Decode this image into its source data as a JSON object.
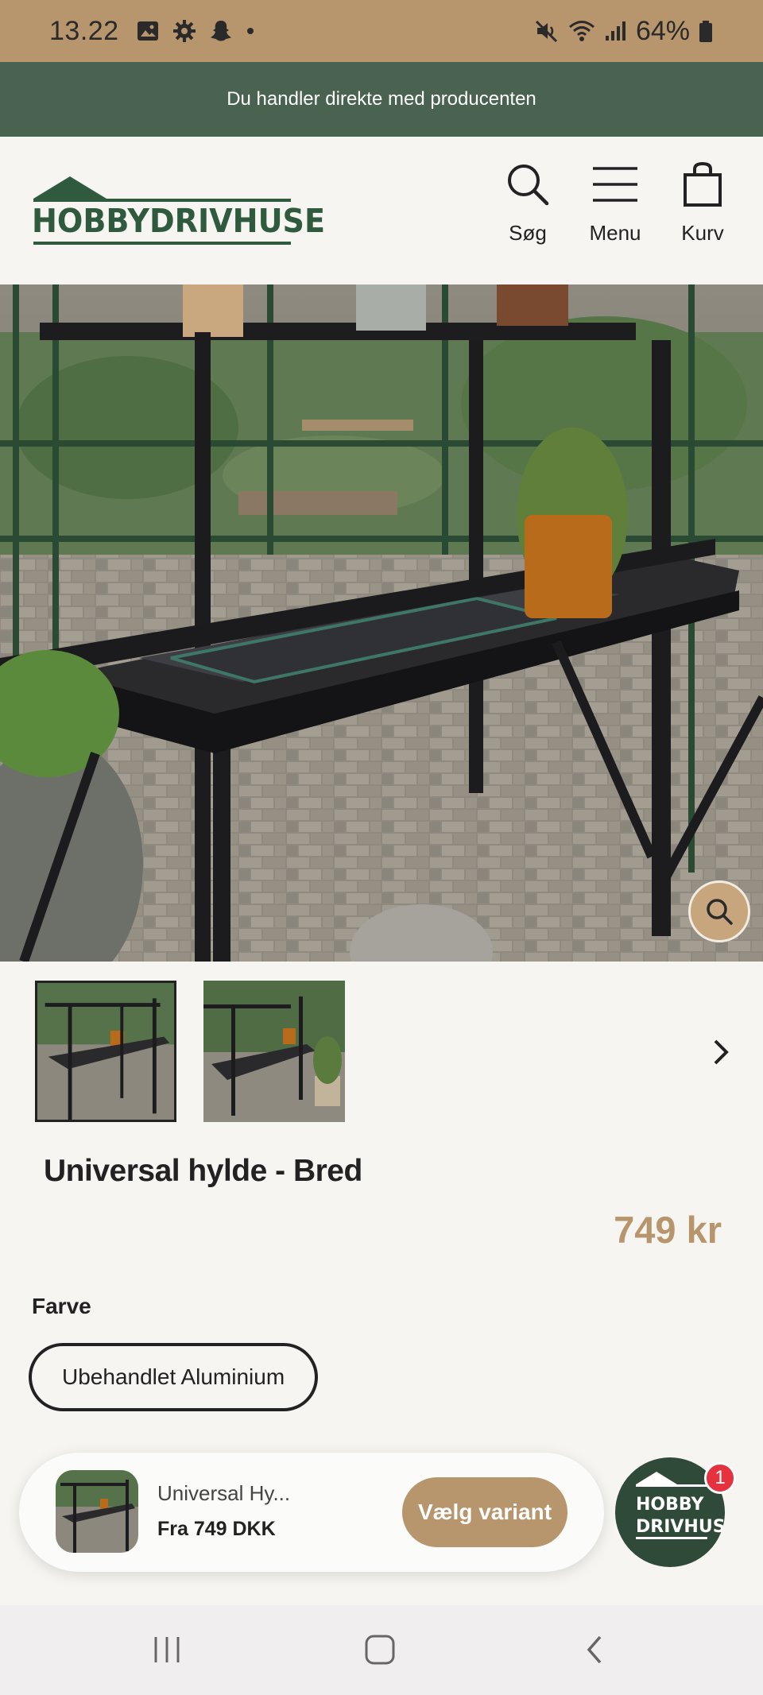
{
  "status_bar": {
    "time": "13.22",
    "battery": "64%",
    "icons": [
      "image-icon",
      "gear-icon",
      "snapchat-icon",
      "dot-icon",
      "mute-icon",
      "wifi-icon",
      "signal-icon",
      "battery-icon"
    ]
  },
  "announcement": {
    "text": "Du handler direkte med producenten"
  },
  "header": {
    "logo_text": "HOBBYDRIVHUSE",
    "nav": [
      {
        "label": "Søg",
        "icon": "search-icon"
      },
      {
        "label": "Menu",
        "icon": "hamburger-icon"
      },
      {
        "label": "Kurv",
        "icon": "bag-icon"
      }
    ]
  },
  "gallery": {
    "thumbnail_count": 2,
    "selected_index": 0
  },
  "product": {
    "title": "Universal hylde - Bred",
    "price": "749 kr",
    "option_label": "Farve",
    "option_value": "Ubehandlet Aluminium"
  },
  "sticky_bar": {
    "name": "Universal Hy...",
    "price": "Fra 749 DKK",
    "button": "Vælg variant"
  },
  "chat": {
    "logo_line1": "HOBBY",
    "logo_line2": "DRIVHUSE",
    "badge": "1"
  },
  "colors": {
    "status_bar": "#b8966d",
    "announcement": "#4a6350",
    "brand_green": "#2f5a3e",
    "accent": "#b8966d",
    "badge": "#e5323e"
  }
}
